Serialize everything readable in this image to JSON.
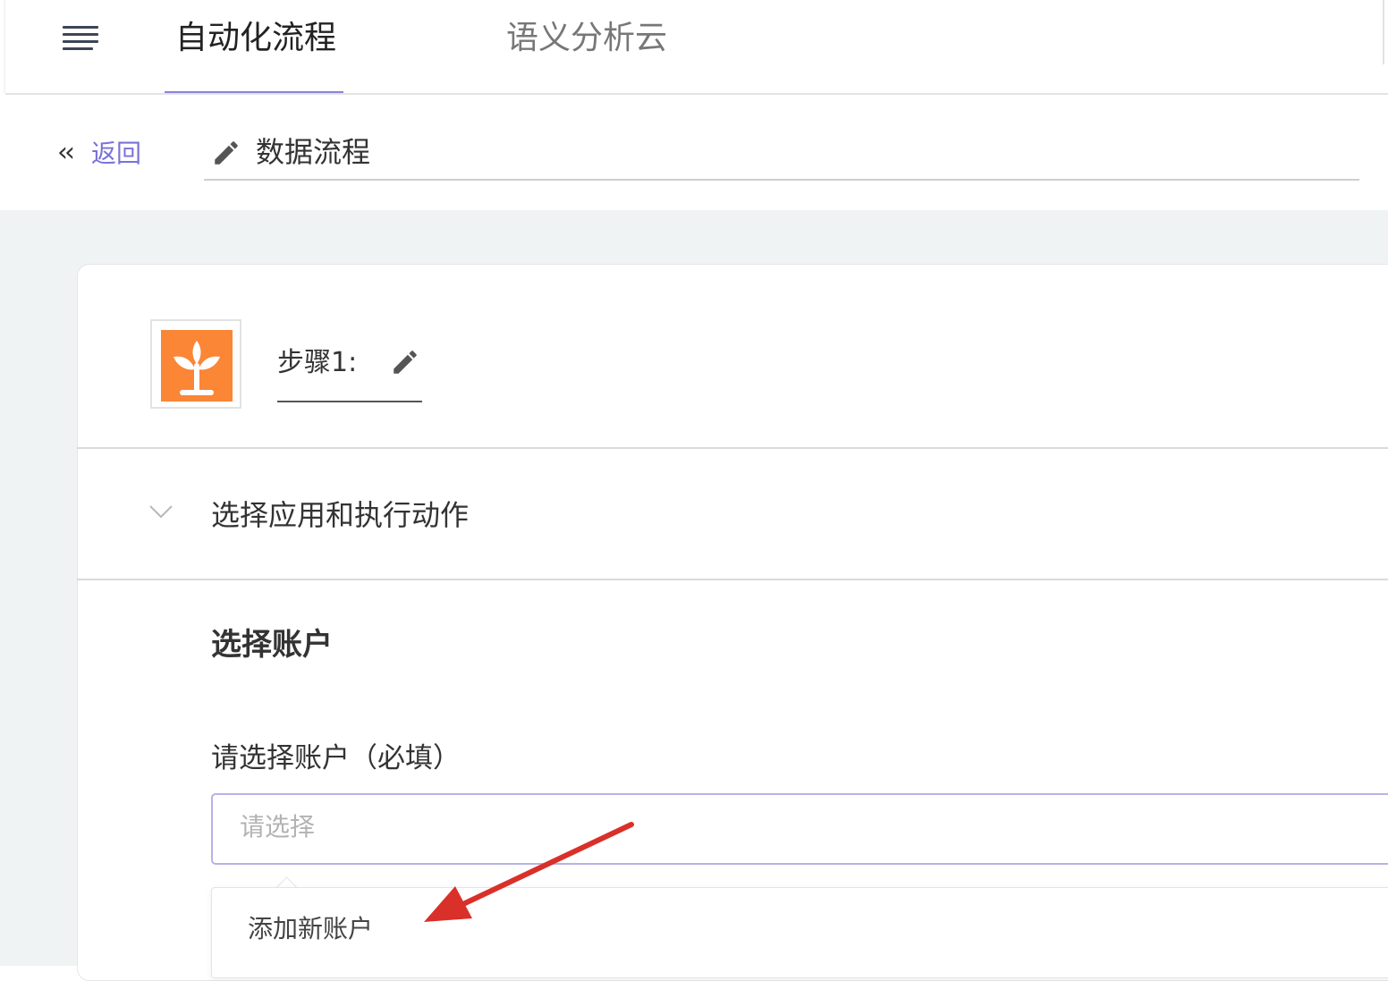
{
  "nav": {
    "tabs": [
      {
        "label": "自动化流程",
        "active": true
      },
      {
        "label": "语义分析云",
        "active": false
      }
    ]
  },
  "header": {
    "back_label": "返回",
    "flow_title": "数据流程"
  },
  "step": {
    "label": "步骤1:",
    "logo_color": "#fa8636"
  },
  "section": {
    "title": "选择应用和执行动作"
  },
  "account": {
    "heading": "选择账户",
    "field_label": "请选择账户（必填）",
    "placeholder": "请选择",
    "dropdown_items": [
      "添加新账户"
    ]
  },
  "colors": {
    "accent": "#7a72d8",
    "annotation_arrow": "#d9302a"
  }
}
